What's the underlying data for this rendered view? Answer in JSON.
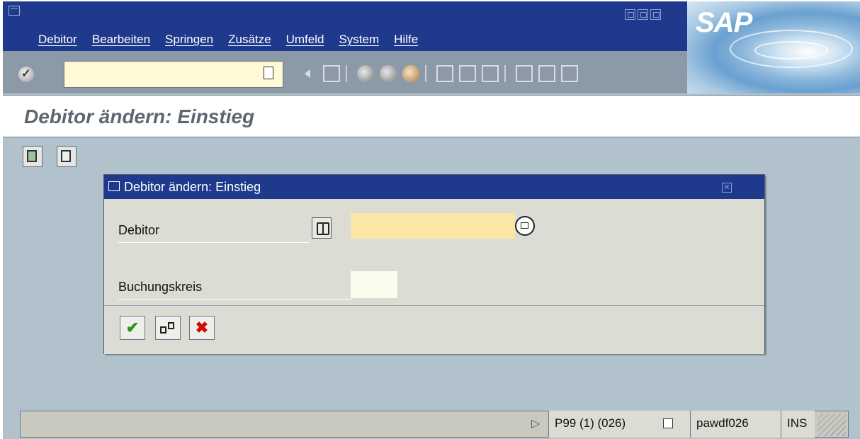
{
  "menubar": {
    "items": [
      "Debitor",
      "Bearbeiten",
      "Springen",
      "Zusätze",
      "Umfeld",
      "System",
      "Hilfe"
    ],
    "logo": "SAP"
  },
  "toolbar": {
    "command_field_value": "",
    "icons": [
      "enter-icon",
      "back-icon",
      "save-icon",
      "back-green-icon",
      "exit-icon",
      "cancel-icon",
      "print-icon",
      "find-icon",
      "find-next-icon",
      "first-page-icon",
      "previous-page-icon",
      "next-page-icon"
    ]
  },
  "title": "Debitor ändern: Einstieg",
  "dialog": {
    "title": "Debitor ändern: Einstieg",
    "fields": {
      "debitor_label": "Debitor",
      "debitor_value": "",
      "bukrs_label": "Buchungskreis",
      "bukrs_value": ""
    },
    "footer": {
      "ok": "✔",
      "cancel": "✖"
    }
  },
  "statusbar": {
    "system": "P99 (1) (026)",
    "host": "pawdf026",
    "mode": "INS"
  },
  "colors": {
    "titlebar_blue": "#1f3a8c",
    "input_required": "#fae6a5",
    "background": "#b2c2cd"
  }
}
